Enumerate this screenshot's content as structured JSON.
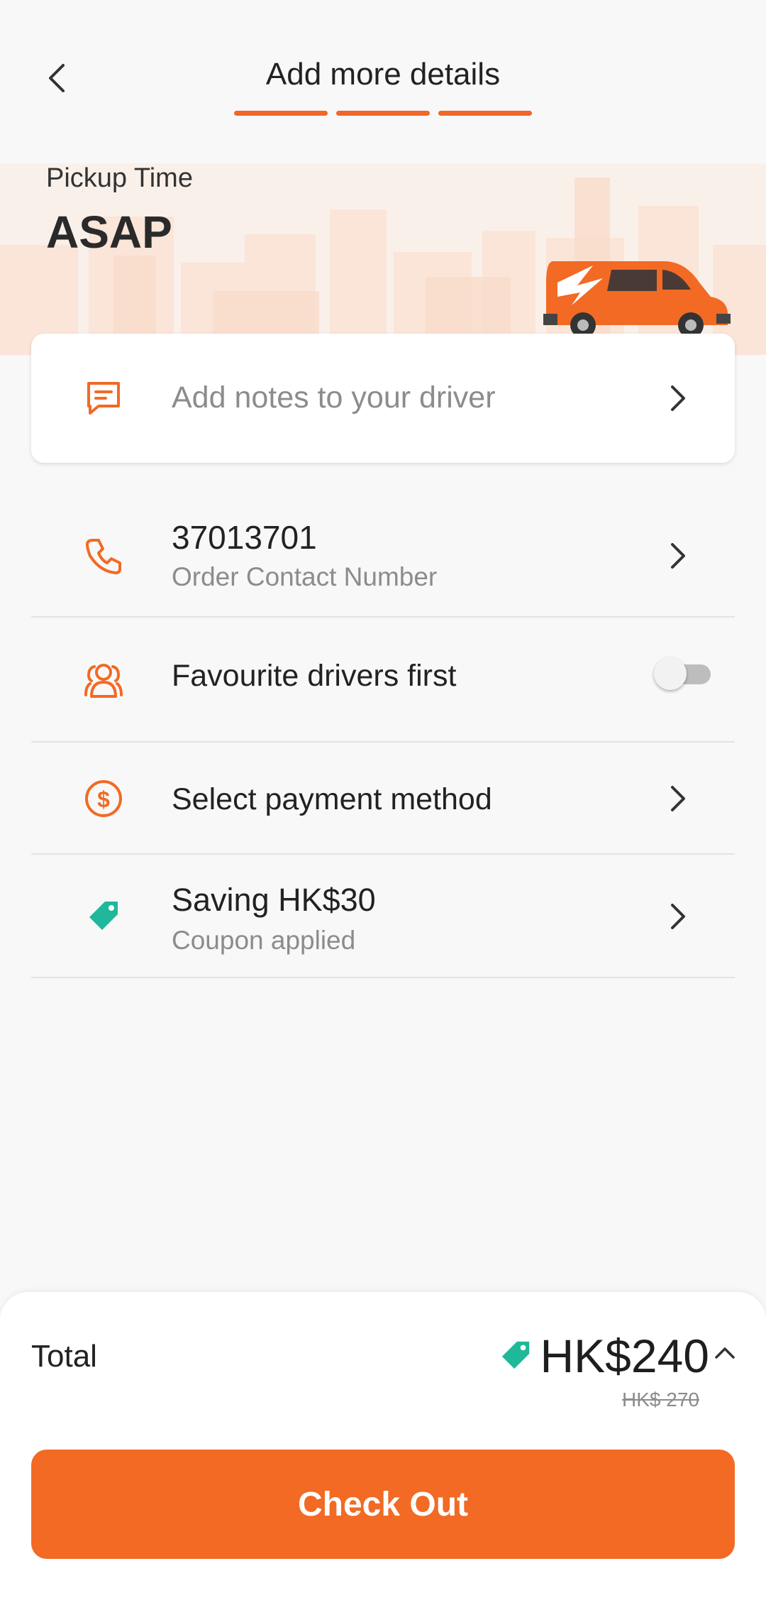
{
  "header": {
    "title": "Add more details",
    "steps_total": 3,
    "steps_completed": 3
  },
  "pickup": {
    "label": "Pickup Time",
    "value": "ASAP"
  },
  "notes": {
    "placeholder": "Add notes to your driver",
    "icon": "message-icon"
  },
  "contact": {
    "number": "37013701",
    "label": "Order Contact Number",
    "icon": "phone-icon"
  },
  "favourite": {
    "label": "Favourite drivers first",
    "enabled": false,
    "icon": "drivers-icon"
  },
  "payment": {
    "label": "Select payment method",
    "icon": "dollar-icon"
  },
  "coupon": {
    "title": "Saving HK$30",
    "subtitle": "Coupon applied",
    "icon": "tag-icon"
  },
  "summary": {
    "total_label": "Total",
    "total_price": "HK$240",
    "original_price": "HK$ 270",
    "checkout_label": "Check Out"
  },
  "colors": {
    "accent": "#f26a24",
    "coupon": "#1fb89a"
  }
}
